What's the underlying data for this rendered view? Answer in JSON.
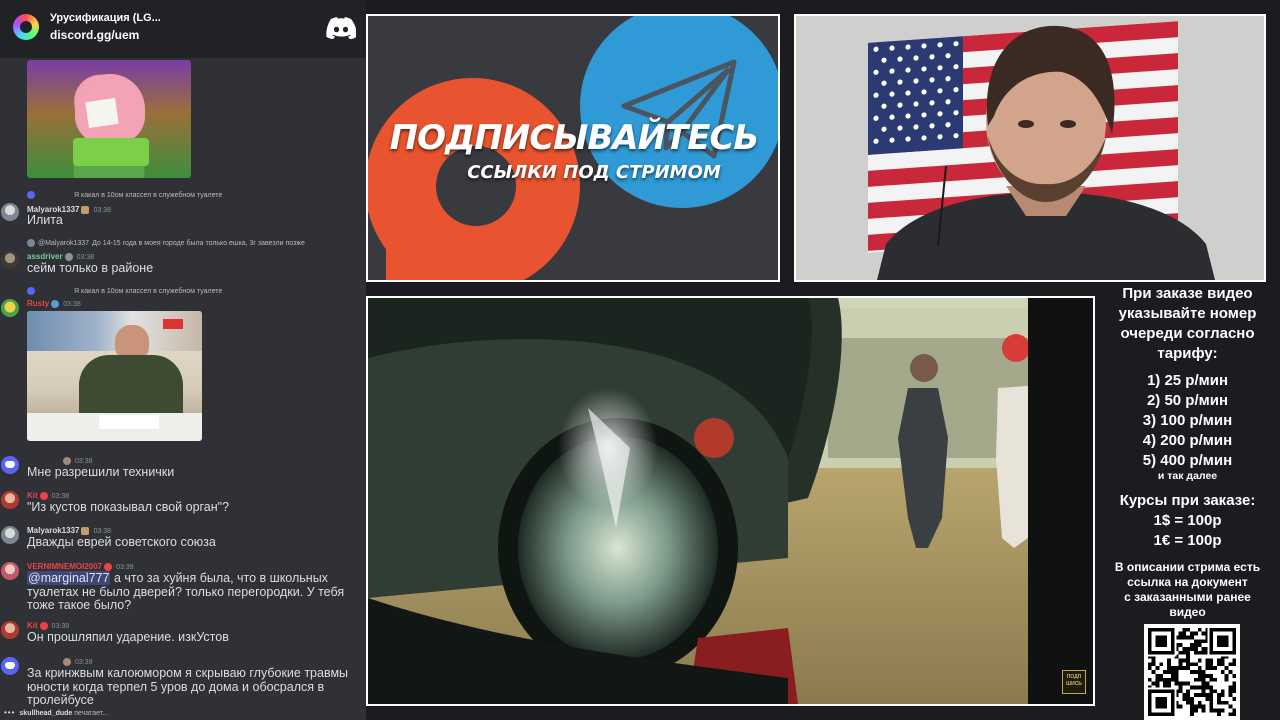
{
  "chat": {
    "server_name": "Урусификация (LG...",
    "server_invite": "discord.gg/uem",
    "messages": [
      {
        "reply": "Я какал в 10ом классеп в служебном туалете",
        "author": "Malyarok1337",
        "time": "03:38",
        "text": "Илита"
      },
      {
        "reply_name": "@Malyarok1337",
        "reply": "До 14-15 года в моея городе была только ешка, 3г завезли позже",
        "author": "assdriver",
        "time": "03:38",
        "text": "сейм только в районе"
      },
      {
        "reply": "Я какал в 10ом классеп в служебном туалете",
        "author": "Rusty",
        "time": "03:38",
        "embed": "tv-photo"
      },
      {
        "author": "",
        "time": "03:38",
        "text": "Мне разрешили технички"
      },
      {
        "author": "Kit",
        "time": "03:38",
        "text": "\"Из кустов показывал свой орган\"?"
      },
      {
        "author": "Malyarok1337",
        "time": "03:38",
        "text": "Дважды еврей советского союза"
      },
      {
        "author": "VERNIMNEMOI2007",
        "time": "03:39",
        "mention": "@marginal777",
        "text": "а что за хуйня была, что в школьных туалетах не было дверей? только перегородки. У тебя тоже такое было?"
      },
      {
        "author": "Kit",
        "time": "03:39",
        "text": "Он прошляпил ударение. изкУстов"
      },
      {
        "author": "",
        "time": "03:39",
        "text": "За кринжвым калоюмором я скрываю глубокие травмы юности когда терпел  5 уров до дома и обосрался  в тролейбусе"
      }
    ],
    "typing_user": "skullhead_dude",
    "typing_suffix": "печатает..."
  },
  "promo": {
    "title": "ПОДПИСЫВАЙТЕСЬ",
    "subtitle": "ССЫЛКИ ПОД СТРИМОМ"
  },
  "video": {
    "watermark": "ПОДП ШИСЬ"
  },
  "info": {
    "order_lines": [
      "При заказе видео",
      "указывайте номер",
      "очереди согласно",
      "тарифу:"
    ],
    "tariffs": [
      "1) 25 р/мин",
      "2) 50 р/мин",
      "3) 100 р/мин",
      "4) 200 р/мин",
      "5) 400 р/мин"
    ],
    "and_so_on": "и так далее",
    "rates_title": "Курсы при заказе:",
    "rates": [
      "1$ = 100р",
      "1€ = 100р"
    ],
    "description_lines": [
      "В описании стрима есть",
      "ссылка на документ",
      "с заказанными ранее",
      "видео"
    ]
  },
  "colors": {
    "chat_bg": "#2f3136",
    "server_bar": "#202225",
    "blurple": "#5865f2",
    "patreon": "#e8542f",
    "telegram": "#2f9ad6",
    "author_malyarok": "#dcddde",
    "author_assdriver": "#6fcf97",
    "author_rusty": "#ed4245",
    "author_kit": "#ed4245",
    "author_vernim": "#ed4245"
  }
}
